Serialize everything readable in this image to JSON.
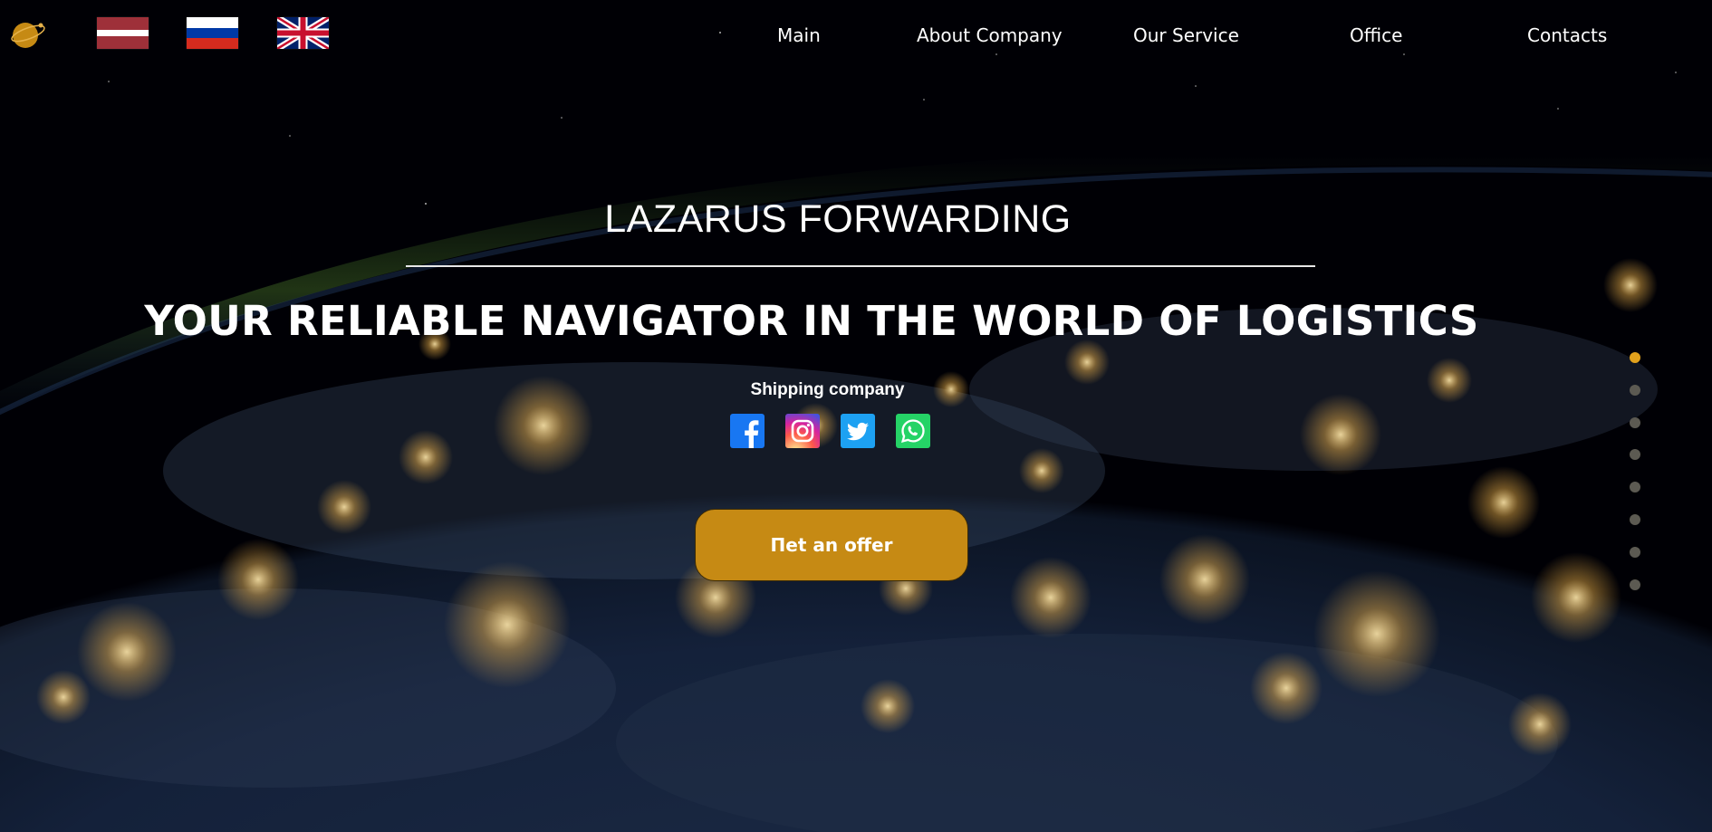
{
  "nav": {
    "items": [
      {
        "label": "Main"
      },
      {
        "label": "About Company"
      },
      {
        "label": "Our Service"
      },
      {
        "label": "Office"
      },
      {
        "label": "Contacts"
      }
    ]
  },
  "languages": [
    {
      "icon": "latvia-flag-icon"
    },
    {
      "icon": "russia-flag-icon"
    },
    {
      "icon": "uk-flag-icon"
    }
  ],
  "hero": {
    "brand": "LAZARUS FORWARDING",
    "headline": "YOUR RELIABLE NAVIGATOR IN THE WORLD OF LOGISTICS",
    "subtitle": "Shipping company",
    "cta_label": "Пet an offer"
  },
  "social": [
    {
      "icon": "facebook-icon"
    },
    {
      "icon": "instagram-icon"
    },
    {
      "icon": "twitter-icon"
    },
    {
      "icon": "whatsapp-icon"
    }
  ],
  "slider": {
    "count": 8,
    "active": 1
  },
  "colors": {
    "accent": "#c68a14",
    "dot_active": "#e2a11c",
    "dot_inactive": "#5c5a52",
    "text": "#ffffff"
  }
}
